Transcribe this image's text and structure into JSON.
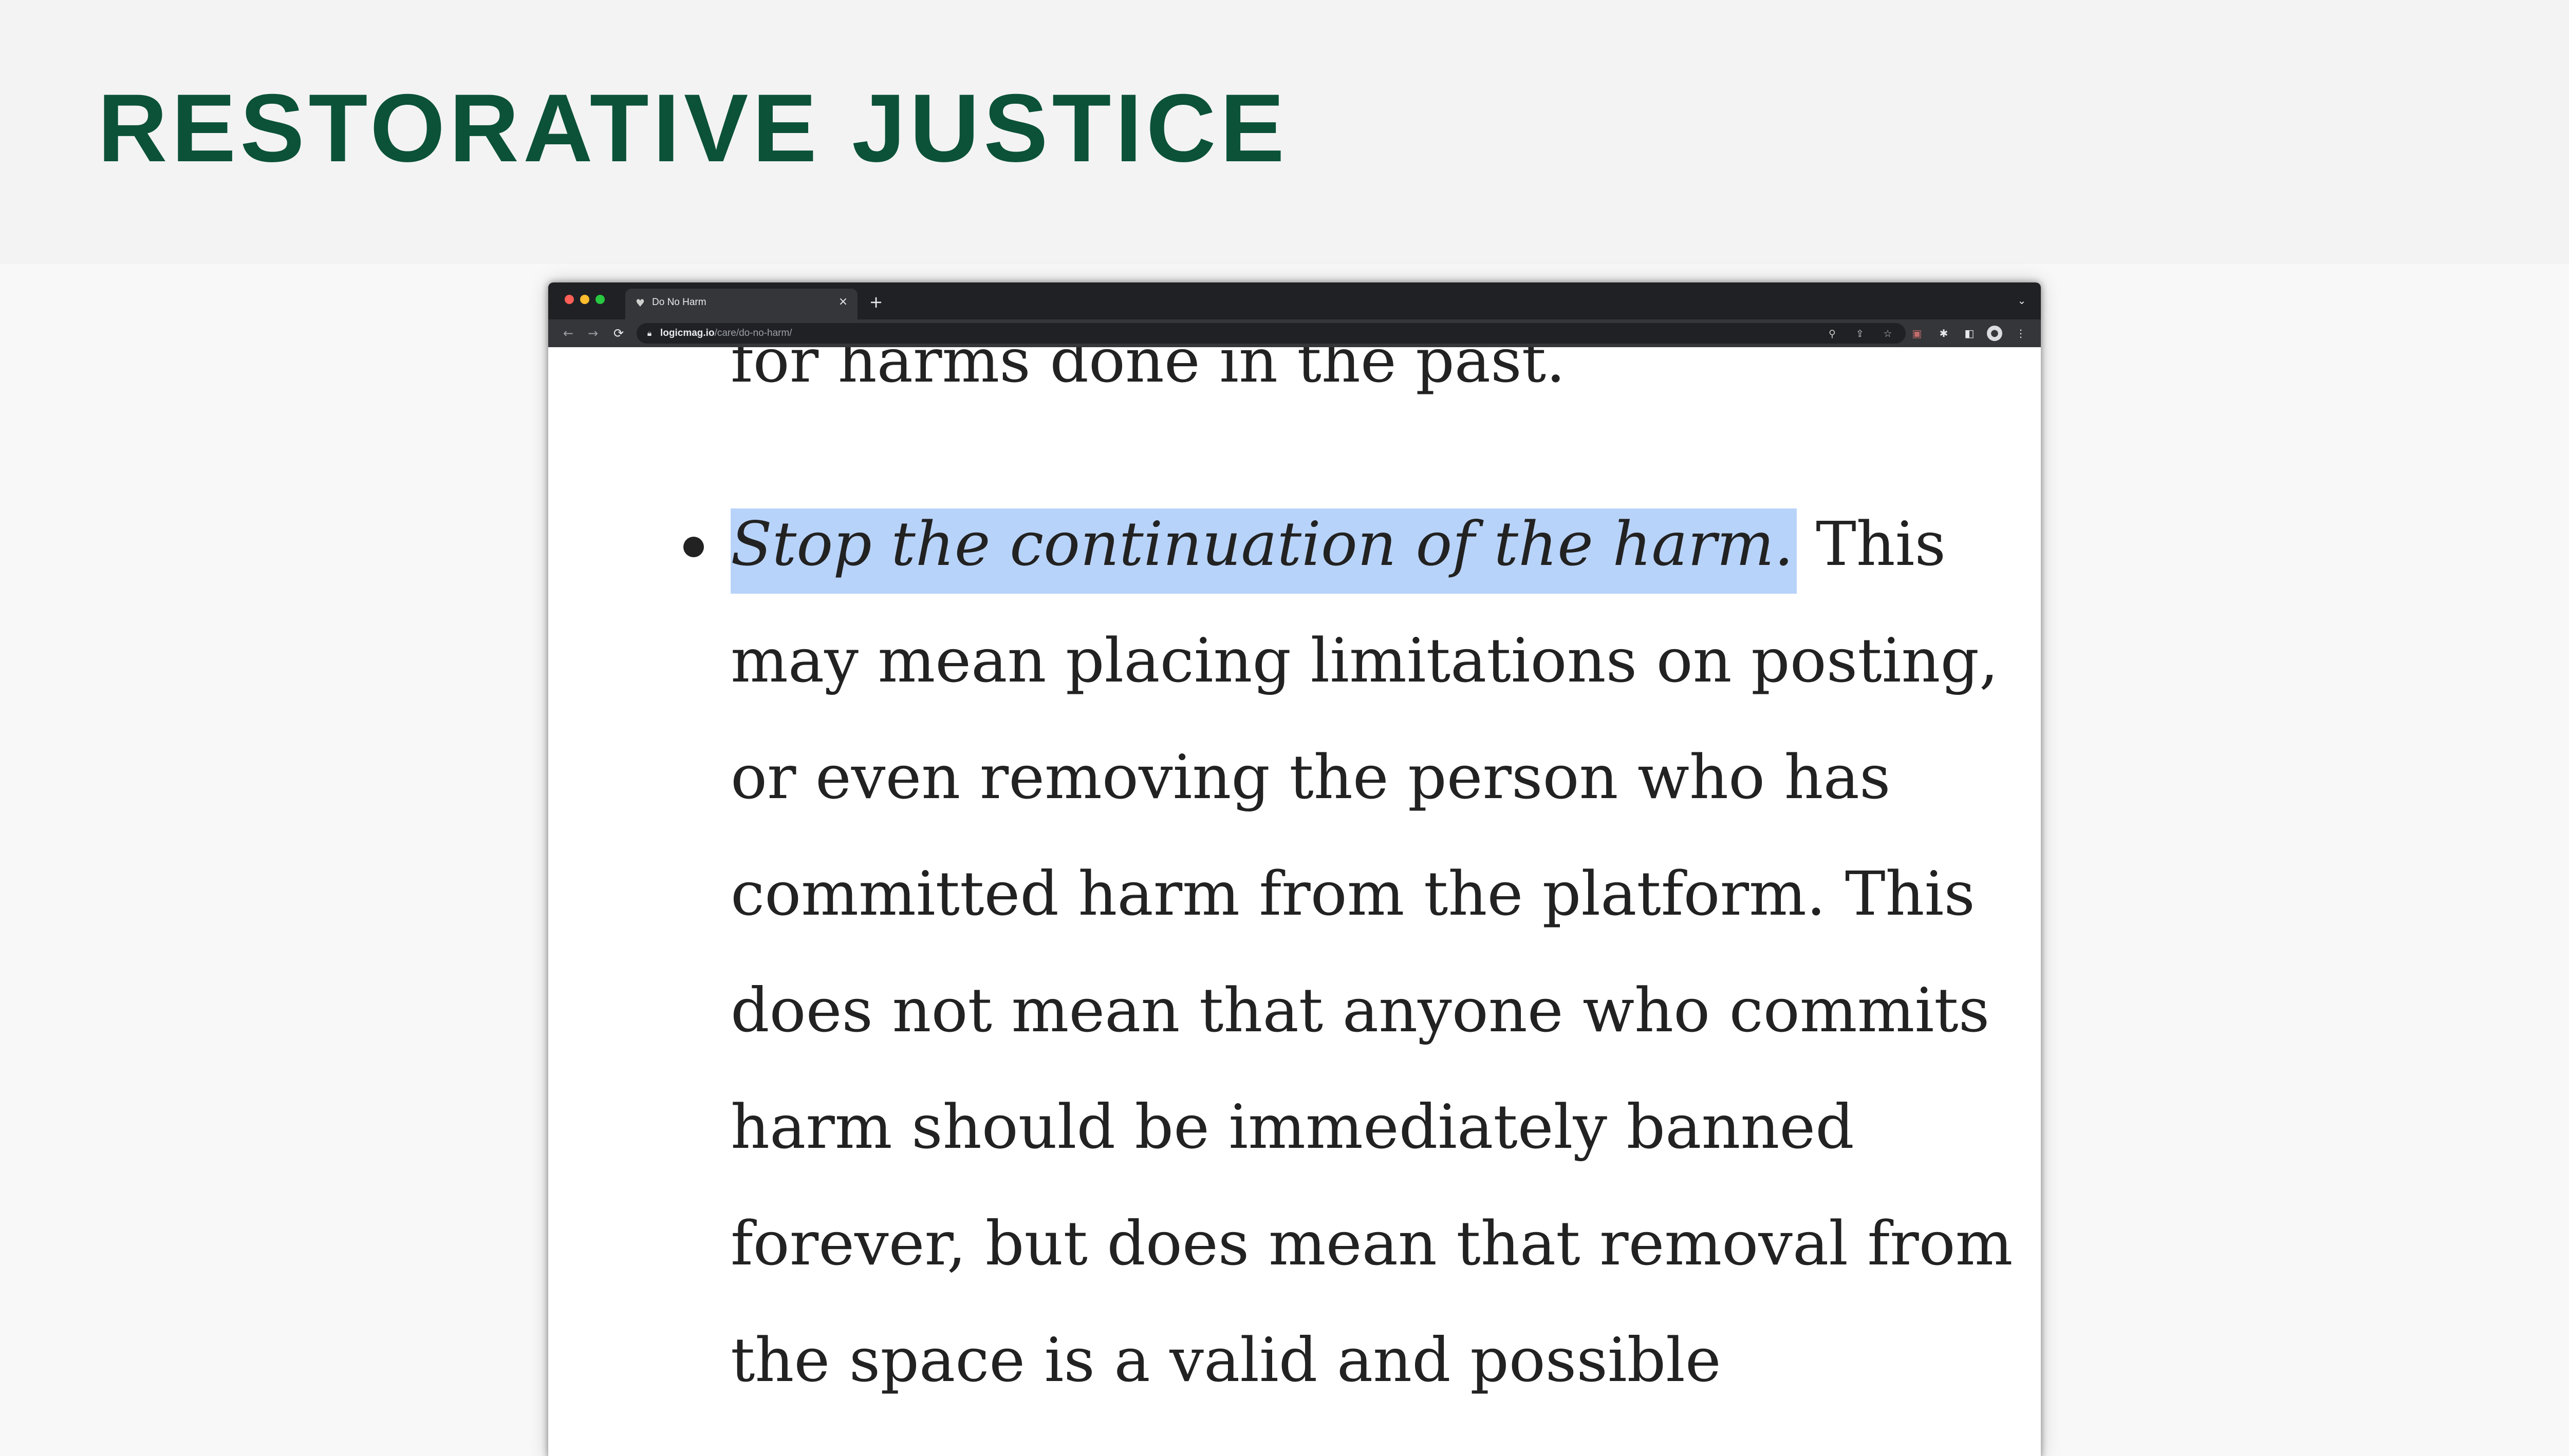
{
  "slide": {
    "title": "RESTORATIVE JUSTICE"
  },
  "browser": {
    "tab": {
      "title": "Do No Harm",
      "favicon": "logic-magazine-icon",
      "close_glyph": "×"
    },
    "new_tab_glyph": "+",
    "tab_search_glyph": "⌄",
    "toolbar": {
      "back_glyph": "←",
      "forward_glyph": "→",
      "reload_glyph": "⟳",
      "url_host": "logicmag.io",
      "url_path": "/care/do-no-harm/",
      "omnibox_icons": [
        "zoom-icon",
        "share-icon",
        "bookmark-star-icon"
      ],
      "extension_icons": [
        "extension-icon",
        "puzzle-icon",
        "side-panel-icon",
        "profile-avatar",
        "menu-icon"
      ]
    }
  },
  "article": {
    "previous_line": "for harms done in the past.",
    "bullet": {
      "highlighted": "Stop the continuation of the harm.",
      "first_line_rest": " This",
      "lines": [
        "may mean placing limitations on posting,",
        "or even removing the person who has",
        "committed harm from the platform. This",
        "does not mean that anyone who commits",
        "harm should be immediately banned",
        "forever, but does mean that removal from",
        "the space is a valid and possible"
      ]
    }
  },
  "colors": {
    "title_green": "#0b5238",
    "highlight_blue": "#b8d3f9",
    "text": "#222222",
    "chrome_dark": "#202124",
    "chrome_toolbar": "#35363a"
  }
}
